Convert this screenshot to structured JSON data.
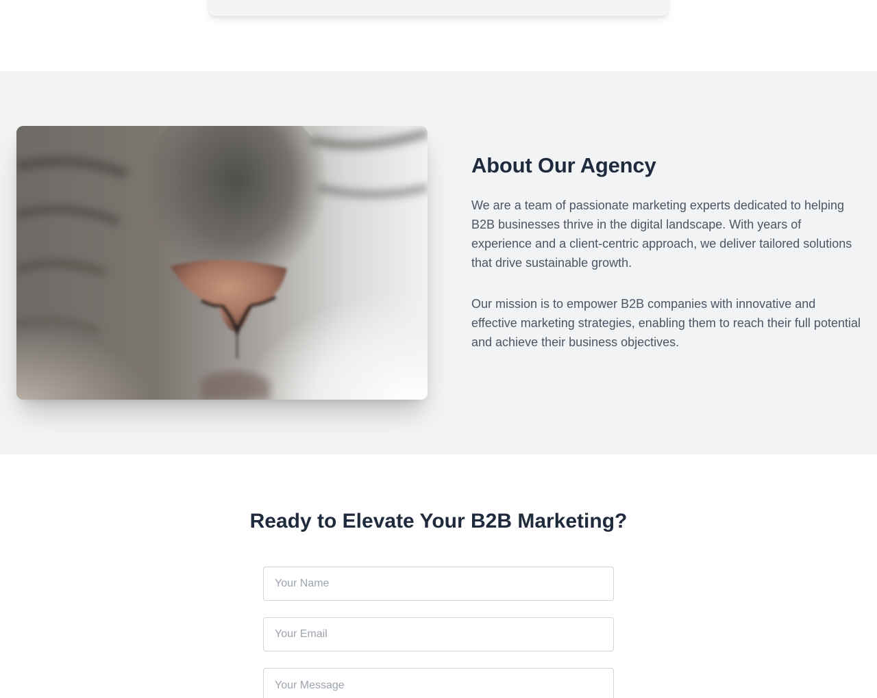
{
  "about": {
    "title": "About Our Agency",
    "paragraphs": [
      "We are a team of passionate marketing experts dedicated to helping B2B businesses thrive in the digital landscape. With years of experience and a client-centric approach, we deliver tailored solutions that drive sustainable growth.",
      "Our mission is to empower B2B companies with innovative and effective marketing strategies, enabling them to reach their full potential and achieve their business objectives."
    ],
    "image_icon": "cat-nose-photo"
  },
  "contact": {
    "title": "Ready to Elevate Your B2B Marketing?",
    "name_placeholder": "Your Name",
    "email_placeholder": "Your Email",
    "message_placeholder": "Your Message"
  },
  "colors": {
    "section_bg": "#f2f3f5",
    "heading": "#1f2a3d",
    "body_text": "#4b5563",
    "input_border": "#d1d5db"
  }
}
